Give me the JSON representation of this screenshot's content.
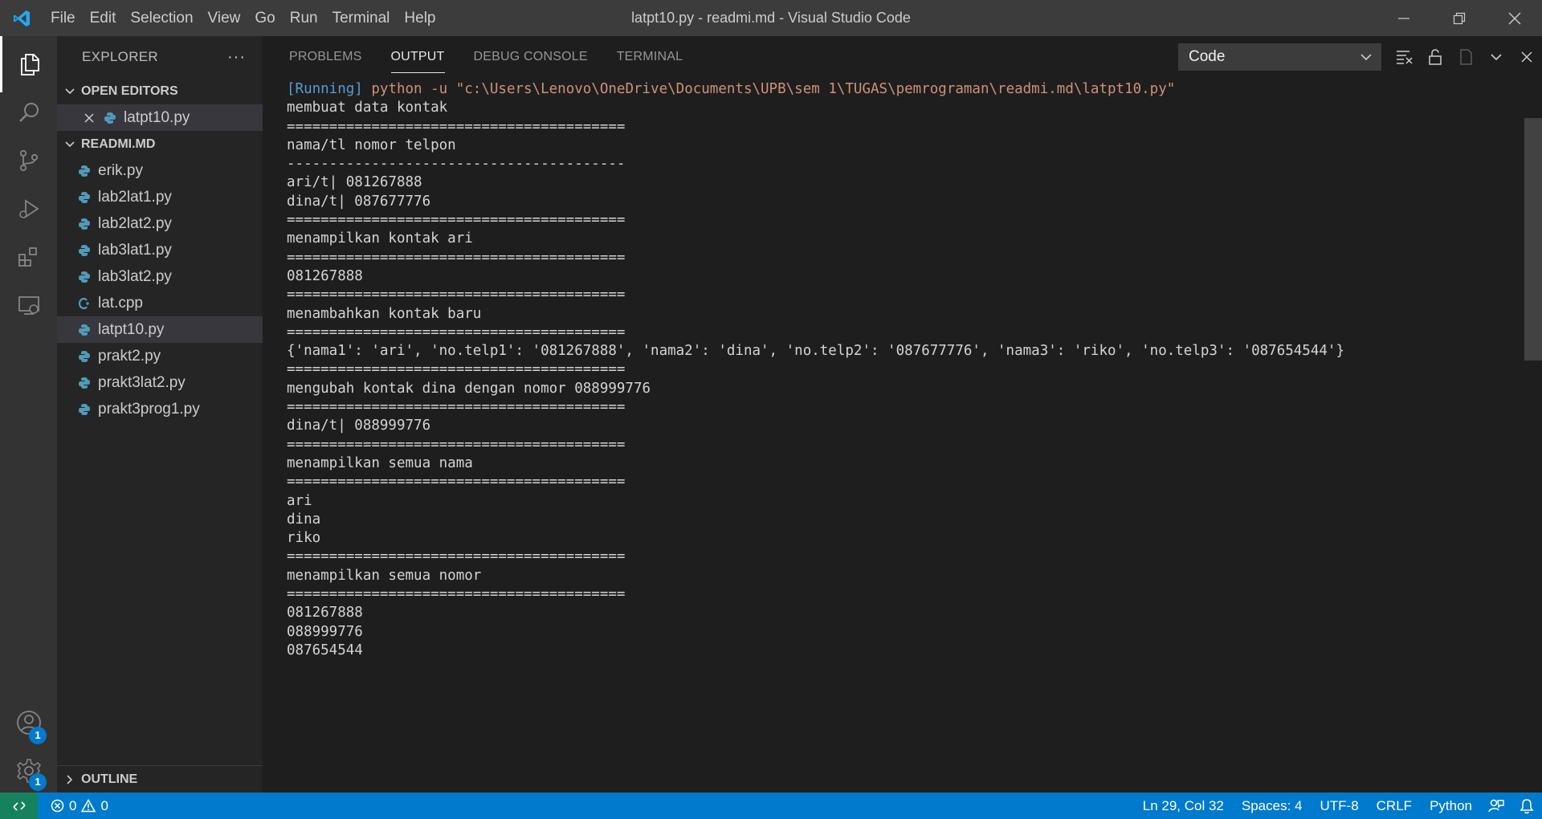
{
  "window": {
    "title": "latpt10.py - readmi.md - Visual Studio Code",
    "menu": [
      "File",
      "Edit",
      "Selection",
      "View",
      "Go",
      "Run",
      "Terminal",
      "Help"
    ]
  },
  "activity_bar": {
    "items": [
      "explorer-icon",
      "search-icon",
      "source-control-icon",
      "run-debug-icon",
      "extensions-icon",
      "remote-explorer-icon"
    ],
    "accounts_badge": "1",
    "settings_badge": "1"
  },
  "sidebar": {
    "title": "EXPLORER",
    "more": "···",
    "open_editors": {
      "label": "OPEN EDITORS",
      "files": [
        {
          "name": "latpt10.py"
        }
      ]
    },
    "folder": {
      "label": "READMI.MD",
      "files": [
        {
          "name": "erik.py",
          "icon": "python"
        },
        {
          "name": "lab2lat1.py",
          "icon": "python"
        },
        {
          "name": "lab2lat2.py",
          "icon": "python"
        },
        {
          "name": "lab3lat1.py",
          "icon": "python"
        },
        {
          "name": "lab3lat2.py",
          "icon": "python"
        },
        {
          "name": "lat.cpp",
          "icon": "cpp"
        },
        {
          "name": "latpt10.py",
          "icon": "python",
          "selected": true
        },
        {
          "name": "prakt2.py",
          "icon": "python"
        },
        {
          "name": "prakt3lat2.py",
          "icon": "python"
        },
        {
          "name": "prakt3prog1.py",
          "icon": "python"
        }
      ]
    },
    "outline_label": "OUTLINE"
  },
  "panel": {
    "tabs": [
      "PROBLEMS",
      "OUTPUT",
      "DEBUG CONSOLE",
      "TERMINAL"
    ],
    "active_tab": "OUTPUT",
    "channel_select": "Code",
    "output": {
      "running_prefix": "[Running]",
      "command": "python -u \"c:\\Users\\Lenovo\\OneDrive\\Documents\\UPB\\sem 1\\TUGAS\\pemrograman\\readmi.md\\latpt10.py\"",
      "lines": [
        "membuat data kontak",
        "========================================",
        "nama/tl nomor telpon",
        "----------------------------------------",
        "ari/t| 081267888",
        "dina/t| 087677776",
        "========================================",
        "menampilkan kontak ari",
        "========================================",
        "081267888",
        "========================================",
        "menambahkan kontak baru",
        "========================================",
        "{'nama1': 'ari', 'no.telp1': '081267888', 'nama2': 'dina', 'no.telp2': '087677776', 'nama3': 'riko', 'no.telp3': '087654544'}",
        "========================================",
        "mengubah kontak dina dengan nomor 088999776",
        "========================================",
        "dina/t| 088999776",
        "========================================",
        "menampilkan semua nama",
        "========================================",
        "ari",
        "dina",
        "riko",
        "========================================",
        "menampilkan semua nomor",
        "========================================",
        "081267888",
        "088999776",
        "087654544"
      ]
    }
  },
  "status_bar": {
    "errors": "0",
    "warnings": "0",
    "cursor": "Ln 29, Col 32",
    "spaces": "Spaces: 4",
    "encoding": "UTF-8",
    "eol": "CRLF",
    "language": "Python"
  },
  "colors": {
    "accent": "#007acc",
    "remote": "#16825d",
    "running": "#569cd6",
    "command": "#ce9178"
  }
}
